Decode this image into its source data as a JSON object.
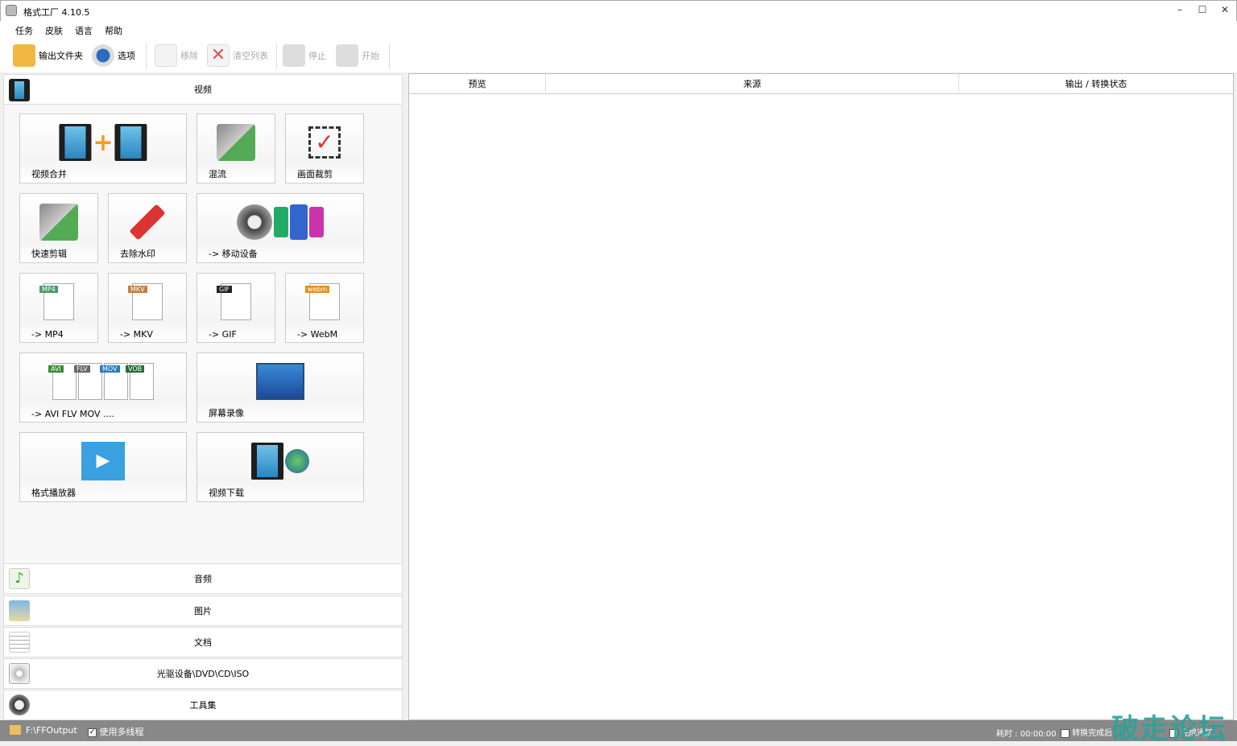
{
  "window": {
    "title": "格式工厂 4.10.5",
    "controls": [
      "–",
      "☐",
      "✕"
    ]
  },
  "menu": [
    "任务",
    "皮肤",
    "语言",
    "帮助"
  ],
  "toolbar": [
    {
      "label": "输出文件夹",
      "icon": "folder-icon",
      "enabled": true
    },
    {
      "label": "选项",
      "icon": "gear-icon",
      "enabled": true
    },
    {
      "label": "移除",
      "icon": "remove-file-icon",
      "enabled": false
    },
    {
      "label": "清空列表",
      "icon": "clear-list-icon",
      "enabled": false
    },
    {
      "label": "停止",
      "icon": "stop-icon",
      "enabled": false
    },
    {
      "label": "开始",
      "icon": "start-icon",
      "enabled": false
    }
  ],
  "video_category": {
    "label": "视频",
    "icon": "film-icon"
  },
  "tiles": [
    {
      "label": "视频合并",
      "icon": "merge-video-icon"
    },
    {
      "label": "混流",
      "icon": "mux-icon"
    },
    {
      "label": "画面裁剪",
      "icon": "crop-icon"
    },
    {
      "label": "快速剪辑",
      "icon": "quick-cut-icon"
    },
    {
      "label": "去除水印",
      "icon": "remove-watermark-icon"
    },
    {
      "label": "-> 移动设备",
      "icon": "mobile-device-icon"
    },
    {
      "label": "-> MP4",
      "icon": "mp4-icon",
      "tag": "MP4"
    },
    {
      "label": "-> MKV",
      "icon": "mkv-icon",
      "tag": "MKV"
    },
    {
      "label": "-> GIF",
      "icon": "gif-icon",
      "tag": "GIF"
    },
    {
      "label": "-> WebM",
      "icon": "webm-icon",
      "tag": "webm"
    },
    {
      "label": "-> AVI FLV MOV ....",
      "icon": "multi-format-icon",
      "tags": [
        "AVI",
        "FLV",
        "MOV",
        "VOB"
      ]
    },
    {
      "label": "屏幕录像",
      "icon": "screen-record-icon"
    },
    {
      "label": "格式播放器",
      "icon": "player-icon"
    },
    {
      "label": "视频下载",
      "icon": "video-download-icon"
    }
  ],
  "categories": [
    {
      "label": "音频",
      "icon": "music-icon"
    },
    {
      "label": "图片",
      "icon": "picture-icon"
    },
    {
      "label": "文档",
      "icon": "document-icon"
    },
    {
      "label": "光驱设备\\DVD\\CD\\ISO",
      "icon": "disc-icon"
    },
    {
      "label": "工具集",
      "icon": "tools-icon"
    }
  ],
  "task_list": {
    "columns": [
      "预览",
      "来源",
      "输出 / 转换状态"
    ]
  },
  "status": {
    "output_path": "F:\\FFOutput",
    "multithread_label": "使用多线程",
    "multithread_checked": true,
    "elapsed": "耗时 : 00:00:00",
    "after_convert_label": "转换完成后",
    "after_convert_checked": false,
    "notify_label": "完成通知"
  },
  "watermark": "破走论坛",
  "colors": {
    "statusbar": "#888888",
    "watermark": "#2aa39a"
  }
}
